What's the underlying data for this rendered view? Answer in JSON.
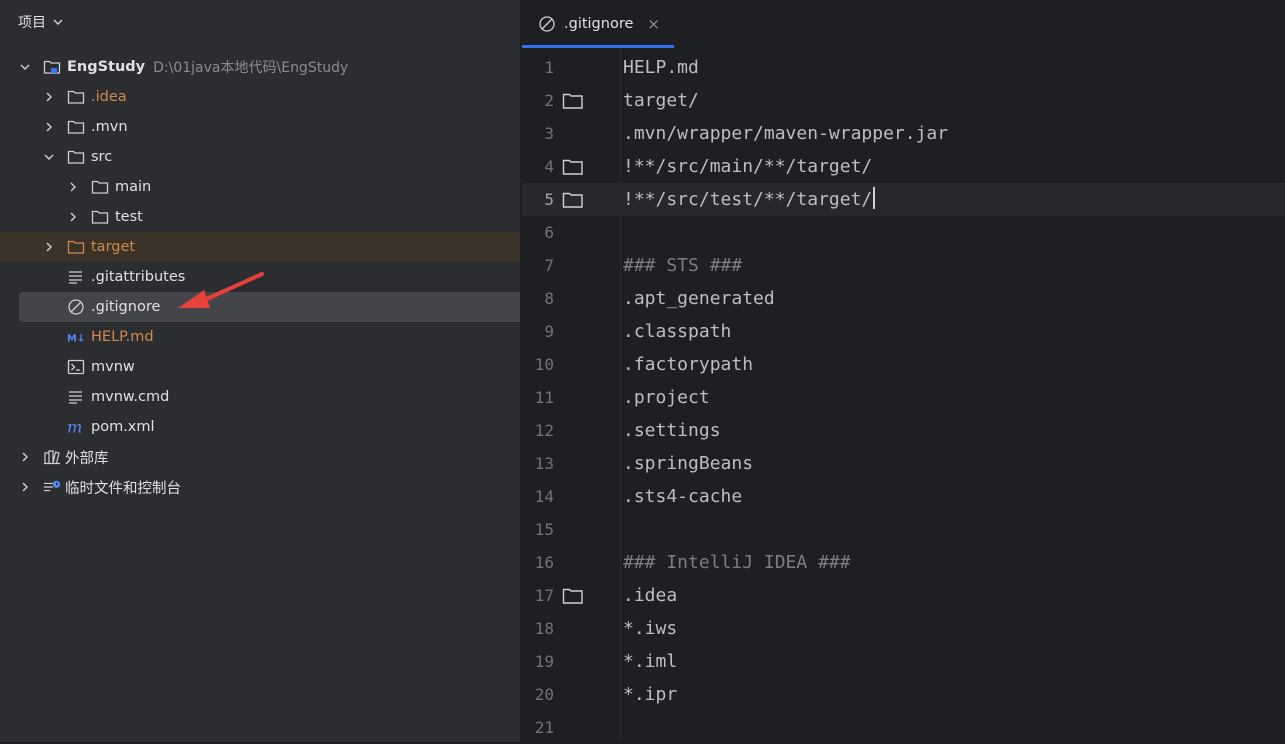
{
  "project_panel": {
    "title": "项目",
    "tree": [
      {
        "label": "EngStudy",
        "path": "D:\\01java本地代码\\EngStudy",
        "icon": "module-folder-icon",
        "expanded": true
      },
      {
        "label": ".idea",
        "icon": "folder-icon",
        "expanded": false
      },
      {
        "label": ".mvn",
        "icon": "folder-icon",
        "expanded": false
      },
      {
        "label": "src",
        "icon": "folder-icon",
        "expanded": true
      },
      {
        "label": "main",
        "icon": "folder-icon",
        "expanded": false
      },
      {
        "label": "test",
        "icon": "folder-icon",
        "expanded": false
      },
      {
        "label": "target",
        "icon": "folder-icon",
        "expanded": false
      },
      {
        "label": ".gitattributes",
        "icon": "text-file-icon"
      },
      {
        "label": ".gitignore",
        "icon": "ignore-file-icon",
        "selected": true
      },
      {
        "label": "HELP.md",
        "icon": "markdown-icon"
      },
      {
        "label": "mvnw",
        "icon": "terminal-icon"
      },
      {
        "label": "mvnw.cmd",
        "icon": "text-file-icon"
      },
      {
        "label": "pom.xml",
        "icon": "maven-icon"
      },
      {
        "label": "外部库",
        "icon": "library-icon",
        "expanded": false
      },
      {
        "label": "临时文件和控制台",
        "icon": "scratches-icon",
        "expanded": false
      }
    ]
  },
  "editor": {
    "tab": {
      "label": ".gitignore",
      "close": "×"
    },
    "lines": [
      {
        "n": "1",
        "text": "HELP.md"
      },
      {
        "n": "2",
        "text": "target/",
        "folder": true
      },
      {
        "n": "3",
        "text": ".mvn/wrapper/maven-wrapper.jar"
      },
      {
        "n": "4",
        "text": "!**/src/main/**/target/",
        "folder": true
      },
      {
        "n": "5",
        "text": "!**/src/test/**/target/",
        "folder": true,
        "current": true
      },
      {
        "n": "6",
        "text": ""
      },
      {
        "n": "7",
        "text": "### STS ###",
        "comment": true
      },
      {
        "n": "8",
        "text": ".apt_generated"
      },
      {
        "n": "9",
        "text": ".classpath"
      },
      {
        "n": "10",
        "text": ".factorypath"
      },
      {
        "n": "11",
        "text": ".project"
      },
      {
        "n": "12",
        "text": ".settings"
      },
      {
        "n": "13",
        "text": ".springBeans"
      },
      {
        "n": "14",
        "text": ".sts4-cache"
      },
      {
        "n": "15",
        "text": ""
      },
      {
        "n": "16",
        "text": "### IntelliJ IDEA ###",
        "comment": true
      },
      {
        "n": "17",
        "text": ".idea",
        "folder": true
      },
      {
        "n": "18",
        "text": "*.iws"
      },
      {
        "n": "19",
        "text": "*.iml"
      },
      {
        "n": "20",
        "text": "*.ipr"
      },
      {
        "n": "21",
        "text": ""
      }
    ]
  },
  "colors": {
    "accent": "#3574f0",
    "excluded_folder": "#d3884d",
    "annotation_arrow": "#e8413c"
  }
}
